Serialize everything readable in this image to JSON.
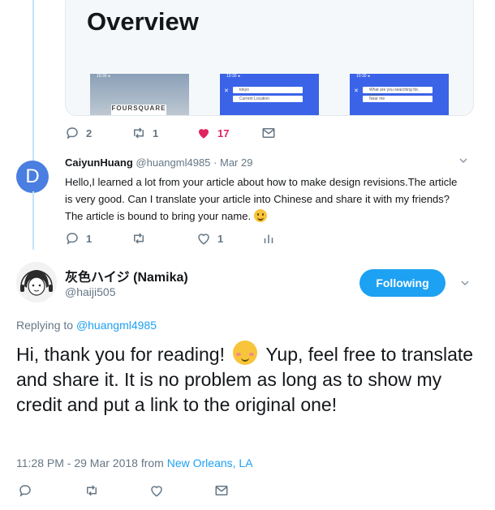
{
  "card": {
    "title": "Overview",
    "thumbs": [
      {
        "status": "10:30 ◂",
        "logo": "FOURSQUARE"
      },
      {
        "status": "10:30 ◂",
        "field1": "tokyo",
        "field2": "Current Location"
      },
      {
        "status": "10:30 ◂",
        "field1": "What are you searching for, Hiroto?",
        "field2": "Near me"
      }
    ]
  },
  "first_actions": {
    "replies": "2",
    "retweets": "1",
    "likes": "17"
  },
  "reply_tweet": {
    "avatar_letter": "D",
    "name": "CaiyunHuang",
    "handle": "@huangml4985",
    "separator": "·",
    "date": "Mar 29",
    "text": "Hello,I learned a lot from your article about how to make design revisions.The article is very good. Can I translate your article into Chinese and share it with my friends? The article is bound to bring your name.",
    "actions": {
      "replies": "1",
      "likes": "1"
    }
  },
  "main_tweet": {
    "name": "灰色ハイジ (Namika)",
    "handle": "@haiji505",
    "follow_label": "Following",
    "replying_prefix": "Replying to",
    "replying_handle": "@huangml4985",
    "text_part1": "Hi, thank you for reading!",
    "text_part2": "Yup, feel free to translate and share it. It is no problem as long as to show my credit and put a link to the original one!",
    "time": "11:28 PM - 29 Mar 2018 from",
    "location": "New Orleans, LA"
  },
  "colors": {
    "accent": "#1da1f2",
    "like": "#e0245e",
    "thread": "#c4e2f7",
    "muted": "#657786"
  }
}
